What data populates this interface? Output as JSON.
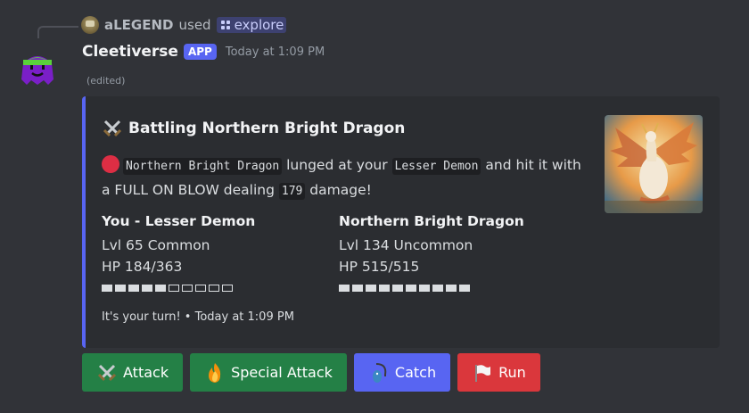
{
  "reply": {
    "username": "aLEGEND",
    "used": "used",
    "command": "explore"
  },
  "message": {
    "author": "Cleetiverse",
    "badge": "APP",
    "timestamp": "Today at 1:09 PM",
    "edited": "(edited)"
  },
  "embed": {
    "accent_color": "#5865f2",
    "title_icon": "crossed-swords",
    "title": "Battling Northern Bright Dragon",
    "description": {
      "icon": "red-circle",
      "enemy": "Northern Bright Dragon",
      "text1": "lunged at your",
      "player_monster": "Lesser Demon",
      "text2": "and hit it with a FULL ON BLOW dealing",
      "damage": "179",
      "text3": "damage!"
    },
    "fields": [
      {
        "name": "You - Lesser Demon",
        "level": "Lvl 65 Common",
        "hp": "HP 184/363",
        "hp_fraction": 0.5,
        "bar_segments": 10
      },
      {
        "name": "Northern Bright Dragon",
        "level": "Lvl 134 Uncommon",
        "hp": "HP 515/515",
        "hp_fraction": 1.0,
        "bar_segments": 10
      }
    ],
    "footer": "It's your turn! • Today at 1:09 PM"
  },
  "buttons": [
    {
      "label": "Attack",
      "icon": "crossed-swords",
      "color": "#248046"
    },
    {
      "label": "Special Attack",
      "icon": "fire",
      "color": "#248046"
    },
    {
      "label": "Catch",
      "icon": "fishing-pole",
      "color": "#5865f2"
    },
    {
      "label": "Run",
      "icon": "white-flag",
      "color": "#da373c"
    }
  ]
}
